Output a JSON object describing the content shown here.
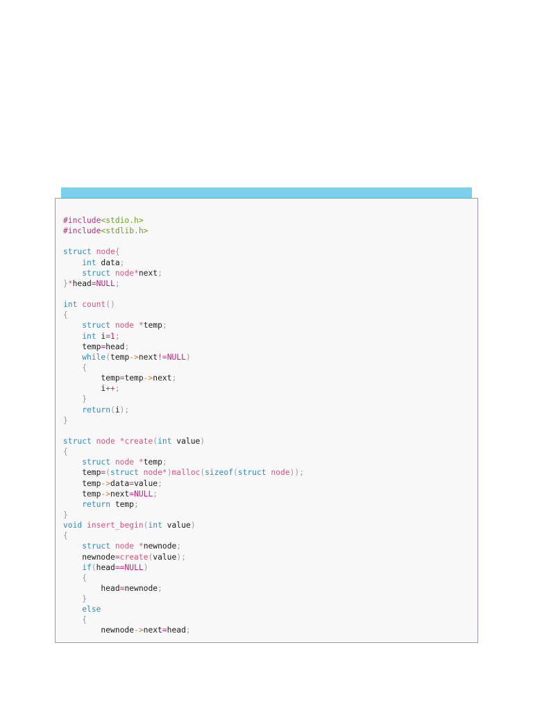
{
  "colors": {
    "header_bar": "#7ccfec",
    "border": "#9d92c4",
    "background": "#f8f8f8"
  },
  "code_lines": [
    [
      [
        "m",
        "#include"
      ],
      [
        "s",
        "<stdio.h>"
      ]
    ],
    [
      [
        "m",
        "#include"
      ],
      [
        "s",
        "<stdlib.h>"
      ]
    ],
    [],
    [
      [
        "k",
        "struct"
      ],
      [
        "i",
        " "
      ],
      [
        "n",
        "node"
      ],
      [
        "p",
        "{"
      ]
    ],
    [
      [
        "i",
        "    "
      ],
      [
        "k",
        "int"
      ],
      [
        "i",
        " data"
      ],
      [
        "p",
        ";"
      ]
    ],
    [
      [
        "i",
        "    "
      ],
      [
        "k",
        "struct"
      ],
      [
        "i",
        " "
      ],
      [
        "n",
        "node"
      ],
      [
        "n",
        "*"
      ],
      [
        "i",
        "next"
      ],
      [
        "p",
        ";"
      ]
    ],
    [
      [
        "p",
        "}"
      ],
      [
        "n",
        "*"
      ],
      [
        "i",
        "head"
      ],
      [
        "o",
        "="
      ],
      [
        "c",
        "NULL"
      ],
      [
        "p",
        ";"
      ]
    ],
    [],
    [
      [
        "k",
        "int"
      ],
      [
        "i",
        " "
      ],
      [
        "n",
        "count"
      ],
      [
        "p",
        "()"
      ]
    ],
    [
      [
        "p",
        "{"
      ]
    ],
    [
      [
        "i",
        "    "
      ],
      [
        "k",
        "struct"
      ],
      [
        "i",
        " "
      ],
      [
        "n",
        "node"
      ],
      [
        "i",
        " "
      ],
      [
        "n",
        "*"
      ],
      [
        "i",
        "temp"
      ],
      [
        "p",
        ";"
      ]
    ],
    [
      [
        "i",
        "    "
      ],
      [
        "k",
        "int"
      ],
      [
        "i",
        " i"
      ],
      [
        "o",
        "="
      ],
      [
        "c",
        "1"
      ],
      [
        "p",
        ";"
      ]
    ],
    [
      [
        "i",
        "    temp"
      ],
      [
        "o",
        "="
      ],
      [
        "i",
        "head"
      ],
      [
        "p",
        ";"
      ]
    ],
    [
      [
        "i",
        "    "
      ],
      [
        "k",
        "while"
      ],
      [
        "p",
        "("
      ],
      [
        "i",
        "temp"
      ],
      [
        "a",
        "->"
      ],
      [
        "i",
        "next"
      ],
      [
        "o",
        "!="
      ],
      [
        "c",
        "NULL"
      ],
      [
        "p",
        ")"
      ]
    ],
    [
      [
        "i",
        "    "
      ],
      [
        "p",
        "{"
      ]
    ],
    [
      [
        "i",
        "        temp"
      ],
      [
        "o",
        "="
      ],
      [
        "i",
        "temp"
      ],
      [
        "a",
        "->"
      ],
      [
        "i",
        "next"
      ],
      [
        "p",
        ";"
      ]
    ],
    [
      [
        "i",
        "        i"
      ],
      [
        "o",
        "++"
      ],
      [
        "p",
        ";"
      ]
    ],
    [
      [
        "i",
        "    "
      ],
      [
        "p",
        "}"
      ]
    ],
    [
      [
        "i",
        "    "
      ],
      [
        "k",
        "return"
      ],
      [
        "p",
        "("
      ],
      [
        "i",
        "i"
      ],
      [
        "p",
        ");"
      ]
    ],
    [
      [
        "p",
        "}"
      ]
    ],
    [],
    [
      [
        "k",
        "struct"
      ],
      [
        "i",
        " "
      ],
      [
        "n",
        "node"
      ],
      [
        "i",
        " "
      ],
      [
        "n",
        "*create"
      ],
      [
        "p",
        "("
      ],
      [
        "k",
        "int"
      ],
      [
        "i",
        " value"
      ],
      [
        "p",
        ")"
      ]
    ],
    [
      [
        "p",
        "{"
      ]
    ],
    [
      [
        "i",
        "    "
      ],
      [
        "k",
        "struct"
      ],
      [
        "i",
        " "
      ],
      [
        "n",
        "node"
      ],
      [
        "i",
        " "
      ],
      [
        "n",
        "*"
      ],
      [
        "i",
        "temp"
      ],
      [
        "p",
        ";"
      ]
    ],
    [
      [
        "i",
        "    temp"
      ],
      [
        "o",
        "="
      ],
      [
        "p",
        "("
      ],
      [
        "k",
        "struct"
      ],
      [
        "i",
        " "
      ],
      [
        "n",
        "node*"
      ],
      [
        "p",
        ")"
      ],
      [
        "n",
        "malloc"
      ],
      [
        "p",
        "("
      ],
      [
        "k",
        "sizeof"
      ],
      [
        "p",
        "("
      ],
      [
        "k",
        "struct"
      ],
      [
        "i",
        " "
      ],
      [
        "n",
        "node"
      ],
      [
        "p",
        "));"
      ]
    ],
    [
      [
        "i",
        "    temp"
      ],
      [
        "a",
        "->"
      ],
      [
        "i",
        "data"
      ],
      [
        "o",
        "="
      ],
      [
        "i",
        "value"
      ],
      [
        "p",
        ";"
      ]
    ],
    [
      [
        "i",
        "    temp"
      ],
      [
        "a",
        "->"
      ],
      [
        "i",
        "next"
      ],
      [
        "o",
        "="
      ],
      [
        "c",
        "NULL"
      ],
      [
        "p",
        ";"
      ]
    ],
    [
      [
        "i",
        "    "
      ],
      [
        "k",
        "return"
      ],
      [
        "i",
        " temp"
      ],
      [
        "p",
        ";"
      ]
    ],
    [
      [
        "p",
        "}"
      ]
    ],
    [
      [
        "k",
        "void"
      ],
      [
        "i",
        " "
      ],
      [
        "n",
        "insert_begin"
      ],
      [
        "p",
        "("
      ],
      [
        "k",
        "int"
      ],
      [
        "i",
        " value"
      ],
      [
        "p",
        ")"
      ]
    ],
    [
      [
        "p",
        "{"
      ]
    ],
    [
      [
        "i",
        "    "
      ],
      [
        "k",
        "struct"
      ],
      [
        "i",
        " "
      ],
      [
        "n",
        "node"
      ],
      [
        "i",
        " "
      ],
      [
        "n",
        "*"
      ],
      [
        "i",
        "newnode"
      ],
      [
        "p",
        ";"
      ]
    ],
    [
      [
        "i",
        "    newnode"
      ],
      [
        "o",
        "="
      ],
      [
        "n",
        "create"
      ],
      [
        "p",
        "("
      ],
      [
        "i",
        "value"
      ],
      [
        "p",
        ");"
      ]
    ],
    [
      [
        "i",
        "    "
      ],
      [
        "k",
        "if"
      ],
      [
        "p",
        "("
      ],
      [
        "i",
        "head"
      ],
      [
        "o",
        "=="
      ],
      [
        "c",
        "NULL"
      ],
      [
        "p",
        ")"
      ]
    ],
    [
      [
        "i",
        "    "
      ],
      [
        "p",
        "{"
      ]
    ],
    [
      [
        "i",
        "        head"
      ],
      [
        "o",
        "="
      ],
      [
        "i",
        "newnode"
      ],
      [
        "p",
        ";"
      ]
    ],
    [
      [
        "i",
        "    "
      ],
      [
        "p",
        "}"
      ]
    ],
    [
      [
        "i",
        "    "
      ],
      [
        "k",
        "else"
      ]
    ],
    [
      [
        "i",
        "    "
      ],
      [
        "p",
        "{"
      ]
    ],
    [
      [
        "i",
        "        newnode"
      ],
      [
        "a",
        "->"
      ],
      [
        "i",
        "next"
      ],
      [
        "o",
        "="
      ],
      [
        "i",
        "head"
      ],
      [
        "p",
        ";"
      ]
    ]
  ]
}
